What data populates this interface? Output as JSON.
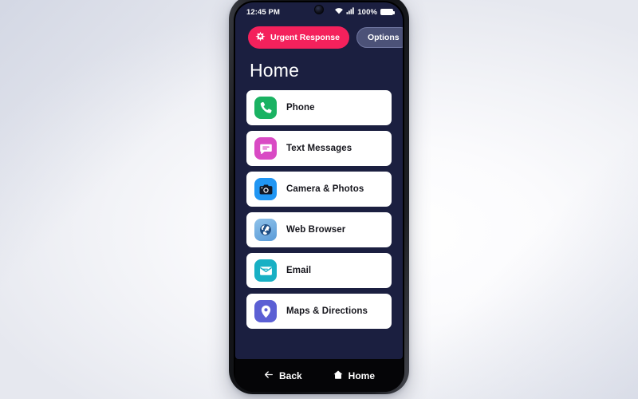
{
  "device": {
    "frame_color": "#17181c",
    "notch": "front-camera-punch-hole"
  },
  "status_bar": {
    "time": "12:45 PM",
    "wifi_icon": "wifi-icon",
    "signal_icon": "cellular-signal-icon",
    "battery_percent": "100%",
    "battery_icon": "battery-full-icon"
  },
  "top_actions": {
    "urgent": {
      "label": "Urgent Response",
      "icon": "star-burst-icon",
      "bg": "#f4215c",
      "fg": "#ffffff"
    },
    "options": {
      "label": "Options",
      "bg": "#4c5278",
      "fg": "#ffffff"
    }
  },
  "screen": {
    "title": "Home",
    "bg": "#1b1f40",
    "title_color": "#ffffff"
  },
  "apps": [
    {
      "label": "Phone",
      "icon": "phone-handset-icon",
      "color": "#1ab262"
    },
    {
      "label": "Text Messages",
      "icon": "speech-bubble-icon",
      "color": "#d94ac4"
    },
    {
      "label": "Camera & Photos",
      "icon": "camera-icon",
      "color": "#2196f3"
    },
    {
      "label": "Web Browser",
      "icon": "globe-icon",
      "color": "#6aa9e0"
    },
    {
      "label": "Email",
      "icon": "envelope-icon",
      "color": "#18b0c4"
    },
    {
      "label": "Maps & Directions",
      "icon": "map-pin-icon",
      "color": "#5b5fd4"
    }
  ],
  "bottom_nav": [
    {
      "label": "Back",
      "icon": "arrow-left-icon"
    },
    {
      "label": "Home",
      "icon": "house-icon"
    }
  ]
}
